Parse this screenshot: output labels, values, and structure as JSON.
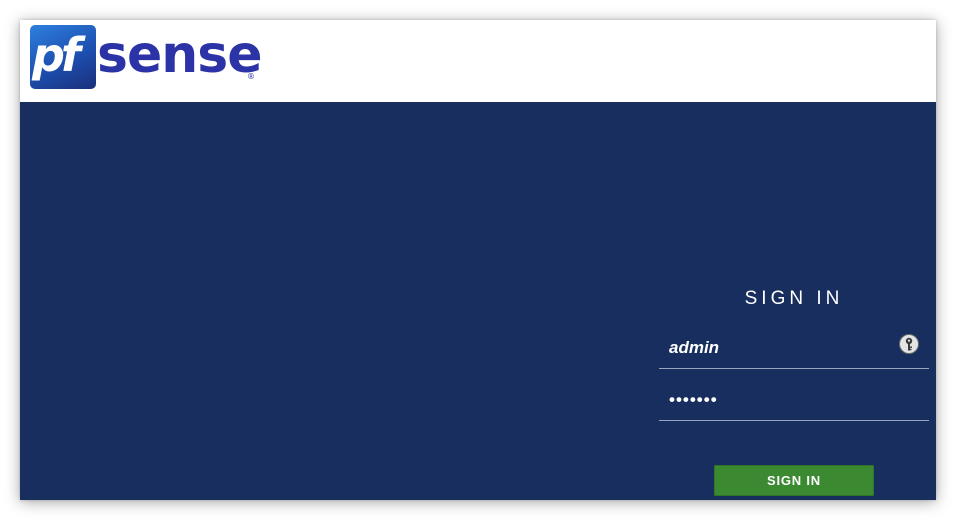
{
  "logo": {
    "box_text": "pf",
    "word": "sense",
    "reg_mark": "®",
    "colors": {
      "word": "#2b33a6",
      "box": "#1d4fb0"
    }
  },
  "login": {
    "title": "SIGN IN",
    "username": {
      "value": "admin",
      "icon": "key-icon"
    },
    "password": {
      "masked_value": "•••••••"
    },
    "submit_label": "SIGN IN"
  },
  "colors": {
    "background": "#182e5f",
    "button": "#3b8a32",
    "header": "#ffffff"
  }
}
